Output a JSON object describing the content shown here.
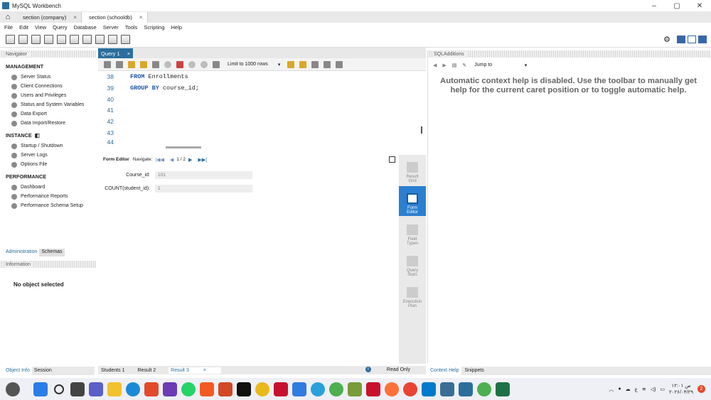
{
  "app": {
    "title": "MySQL Workbench"
  },
  "window_controls": {
    "minimize": "–",
    "maximize": "▢",
    "close": "✕"
  },
  "connection_tabs": [
    {
      "label": "section  (company)",
      "close": "×"
    },
    {
      "label": "section  (schooldb)",
      "close": "×"
    }
  ],
  "menu": [
    "File",
    "Edit",
    "View",
    "Query",
    "Database",
    "Server",
    "Tools",
    "Scripting",
    "Help"
  ],
  "navigator": {
    "title": "Navigator",
    "management": {
      "title": "MANAGEMENT",
      "items": [
        "Server Status",
        "Client Connections",
        "Users and Privileges",
        "Status and System Variables",
        "Data Export",
        "Data Import/Restore"
      ]
    },
    "instance": {
      "title": "INSTANCE",
      "items": [
        "Startup / Shutdown",
        "Server Logs",
        "Options File"
      ]
    },
    "performance": {
      "title": "PERFORMANCE",
      "items": [
        "Dashboard",
        "Performance Reports",
        "Performance Schema Setup"
      ]
    },
    "tabs": [
      "Administration",
      "Schemas"
    ],
    "info_title": "Information",
    "no_selection": "No object selected",
    "bottom_tabs": [
      "Object Info",
      "Session"
    ]
  },
  "query_tab": {
    "label": "Query 1",
    "close": "×"
  },
  "sql_toolbar": {
    "limit_label": "Limit to 1000 rows",
    "limit_caret": "▾"
  },
  "editor": {
    "lines": [
      {
        "num": "38",
        "kw": "FROM",
        "rest": " Enrollments"
      },
      {
        "num": "39",
        "kw": "GROUP BY",
        "rest": " course_id;"
      },
      {
        "num": "40",
        "kw": "",
        "rest": ""
      },
      {
        "num": "41",
        "kw": "",
        "rest": ""
      },
      {
        "num": "42",
        "kw": "",
        "rest": ""
      },
      {
        "num": "43",
        "kw": "",
        "rest": ""
      },
      {
        "num": "44",
        "kw": "",
        "rest": ""
      }
    ]
  },
  "form_editor": {
    "title": "Form Editor",
    "navigate_label": "Navigate:",
    "record": "1 / 2",
    "fields": [
      {
        "label": "Course_id:",
        "value": "101"
      },
      {
        "label": "COUNT(student_id):",
        "value": "1"
      }
    ]
  },
  "result_side": [
    {
      "label": "Result Grid"
    },
    {
      "label": "Form Editor"
    },
    {
      "label": "Field Types"
    },
    {
      "label": "Query Stats"
    },
    {
      "label": "Execution Plan"
    }
  ],
  "result_tabs": [
    "Students 1",
    "Result 2",
    "Result 3"
  ],
  "result_close": "×",
  "read_only": "Read Only",
  "sql_additions": {
    "title": "SQLAdditions",
    "jump_to": "Jump to",
    "help_text": "Automatic context help is disabled. Use the toolbar to manually get help for the current caret position or to toggle automatic help.",
    "tabs": [
      "Context Help",
      "Snippets"
    ]
  },
  "taskbar": {
    "time": "۱۲:۰۱ ص",
    "date": "۲۰۲۶/۰۴/۲۹",
    "lang": "ع",
    "notif": "2"
  }
}
